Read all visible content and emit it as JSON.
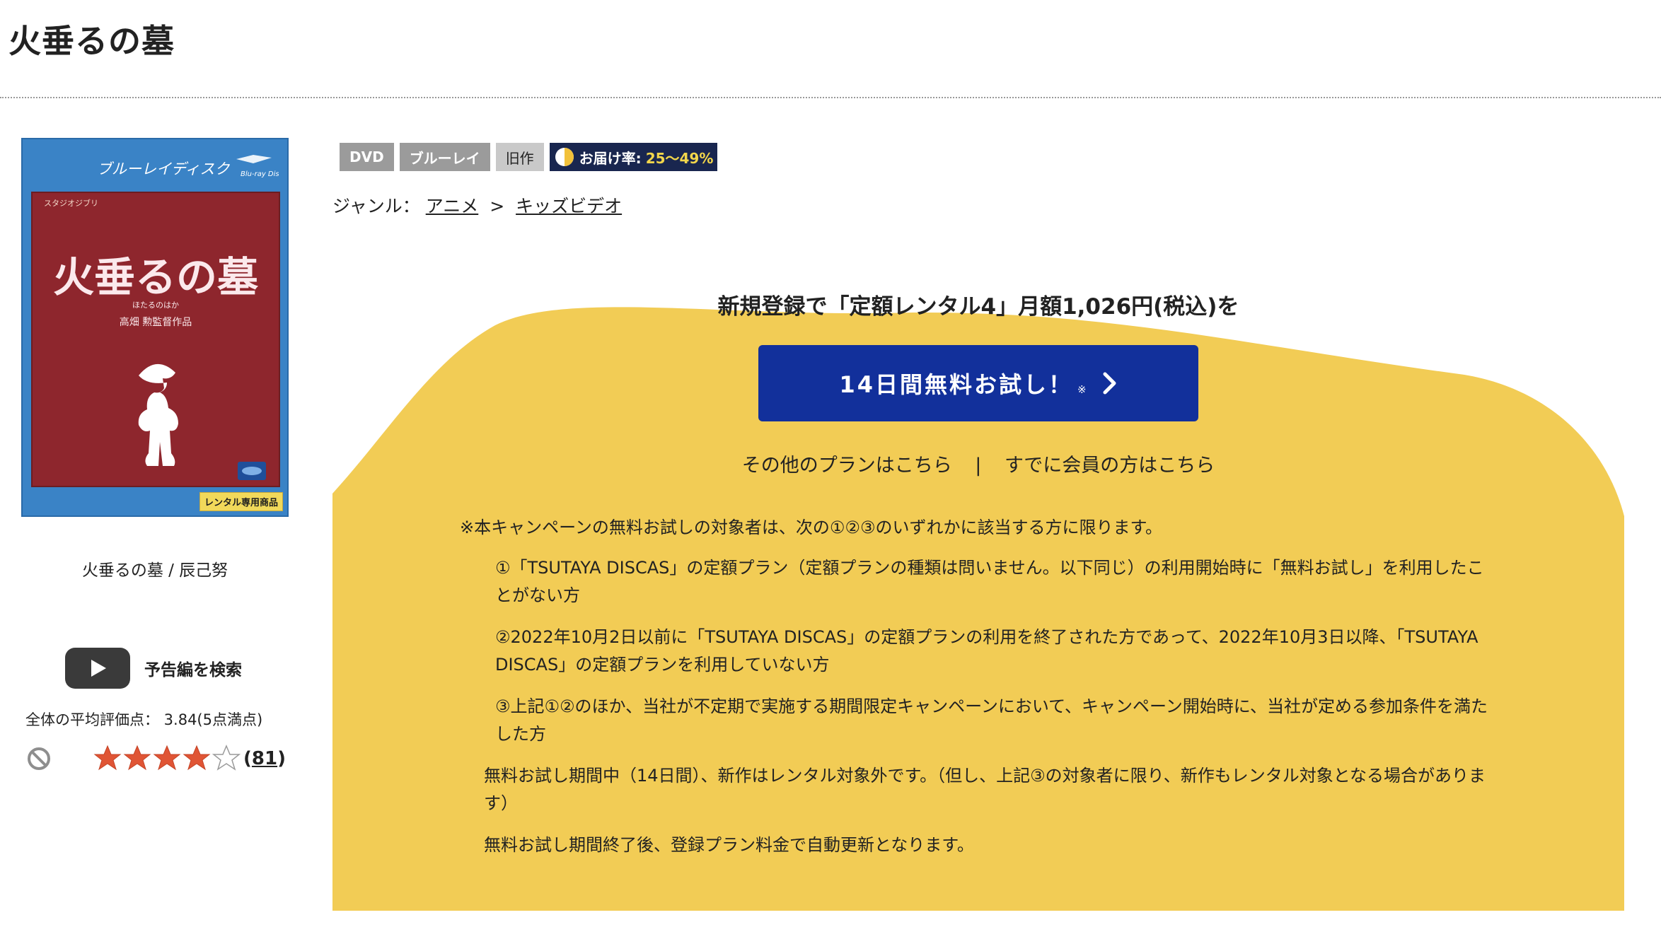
{
  "page": {
    "title": "火垂るの墓"
  },
  "cover": {
    "bluray_text": "ブルーレイディスク",
    "ghibli_text": "スタジオジブリ",
    "title": "火垂るの墓",
    "subtitle": "ほたるのはか",
    "director_credit": "高畑 勲監督作品",
    "rental_tag": "レンタル専用商品"
  },
  "product": {
    "caption": "火垂るの墓 / 辰己努"
  },
  "trailer": {
    "label": "予告編を検索",
    "icon": "play-icon"
  },
  "rating": {
    "average_text": "全体の平均評価点：  3.84(5点満点)",
    "average": 3.84,
    "max": 5,
    "stars_filled": 4,
    "review_count": "81",
    "count_open": "(",
    "count_close": ")"
  },
  "badges": {
    "dvd": "DVD",
    "bluray": "ブルーレイ",
    "old": "旧作",
    "delivery_label": "お届け率:",
    "delivery_rate": "25〜49%"
  },
  "genre": {
    "label": "ジャンル：",
    "level1": "アニメ",
    "separator": ">",
    "level2": "キッズビデオ"
  },
  "campaign": {
    "title": "新規登録で「定額レンタル4」月額1,026円(税込)を",
    "trial_button": "14日間無料お試し！",
    "trial_mark": "※",
    "other_plans": "その他のプランはこちら",
    "pipe": "|",
    "member_link": "すでに会員の方はこちら",
    "note": "※本キャンペーンの無料お試しの対象者は、次の①②③のいずれかに該当する方に限ります。",
    "conditions": [
      "①「TSUTAYA DISCAS」の定額プラン（定額プランの種類は問いません。以下同じ）の利用開始時に「無料お試し」を利用したことがない方",
      "②2022年10月2日以前に「TSUTAYA DISCAS」の定額プランの利用を終了された方であって、2022年10月3日以降、「TSUTAYA DISCAS」の定額プランを利用していない方",
      "③上記①②のほか、当社が不定期で実施する期間限定キャンペーンにおいて、キャンペーン開始時に、当社が定める参加条件を満たした方"
    ],
    "paragraphs": [
      "無料お試し期間中（14日間）、新作はレンタル対象外です。（但し、上記③の対象者に限り、新作もレンタル対象となる場合があります）",
      "無料お試し期間終了後、登録プラン料金で自動更新となります。"
    ]
  },
  "colors": {
    "campaign_yellow": "#f2cc55",
    "button_blue": "#12309b",
    "badge_gray": "#9b9b9b",
    "badge_navy": "#19264f",
    "star_red": "#e05535"
  }
}
